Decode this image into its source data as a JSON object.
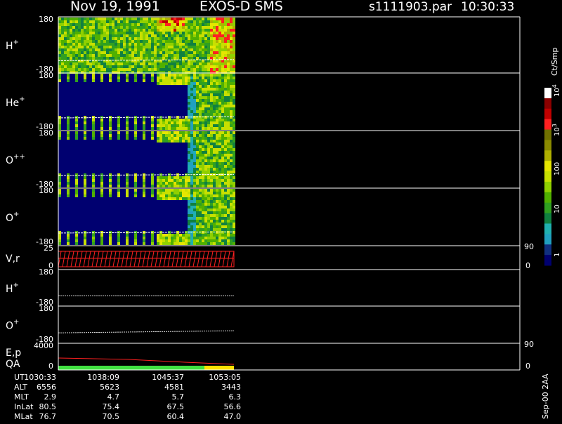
{
  "header": {
    "date": "Nov 19, 1991",
    "instrument": "EXOS-D SMS",
    "file": "s1111903.par",
    "time": "10:30:33"
  },
  "colorbar": {
    "unit": "Ct/Smp",
    "tick_labels": [
      "10^4",
      "10^3",
      "100",
      "10",
      "1"
    ],
    "colors": [
      "#ffffff",
      "#8b0000",
      "#c00000",
      "#ff2020",
      "#707000",
      "#8a8a00",
      "#b0b000",
      "#e6e600",
      "#c8e000",
      "#90d000",
      "#50b000",
      "#30a020",
      "#108040",
      "#20b0b0",
      "#20a0c0",
      "#103080",
      "#000070"
    ]
  },
  "footer_note": "Sep-00 2AA",
  "panels": [
    {
      "id": "h_plus",
      "label_base": "H",
      "label_sup": "+",
      "y_top": "180",
      "y_bottom": "-180",
      "kind": "spectrogram",
      "fill_fraction": 0.34,
      "bg": "#208060"
    },
    {
      "id": "he_plus",
      "label_base": "He",
      "label_sup": "+",
      "y_top": "180",
      "y_bottom": "-180",
      "kind": "spectrogram",
      "fill_fraction": 0.34,
      "bg": "#000070"
    },
    {
      "id": "o_plusplus",
      "label_base": "O",
      "label_sup": "++",
      "y_top": "180",
      "y_bottom": "-180",
      "kind": "spectrogram",
      "fill_fraction": 0.34,
      "bg": "#000070"
    },
    {
      "id": "o_plus",
      "label_base": "O",
      "label_sup": "+",
      "y_top": "180",
      "y_bottom": "-180",
      "kind": "spectrogram",
      "fill_fraction": 0.34,
      "bg": "#000070"
    },
    {
      "id": "v_r",
      "label_base": "V,r",
      "label_sup": "",
      "y_top": "25",
      "y_bottom": "0",
      "right_top": "90",
      "right_bottom": "0",
      "kind": "vr"
    },
    {
      "id": "h_plus_2",
      "label_base": "H",
      "label_sup": "+",
      "y_top": "180",
      "y_bottom": "-180",
      "kind": "line"
    },
    {
      "id": "o_plus_2",
      "label_base": "O",
      "label_sup": "+",
      "y_top": "180",
      "y_bottom": "-180",
      "kind": "line"
    },
    {
      "id": "ep_qa",
      "label_base": "E,p",
      "label_line2": "QA",
      "label_sup": "",
      "y_top": "4000",
      "y_bottom": "0",
      "right_top": "90",
      "right_bottom": "0",
      "kind": "ep"
    }
  ],
  "ephemeris": {
    "rows": [
      {
        "name": "UT",
        "values": [
          "1030:33",
          "1038:09",
          "1045:37",
          "1053:05"
        ]
      },
      {
        "name": "ALT",
        "values": [
          "6556",
          "5623",
          "4581",
          "3443"
        ]
      },
      {
        "name": "MLT",
        "values": [
          "2.9",
          "4.7",
          "5.7",
          "6.3"
        ]
      },
      {
        "name": "InLat",
        "values": [
          "80.5",
          "75.4",
          "67.5",
          "56.6"
        ]
      },
      {
        "name": "MLat",
        "values": [
          "76.7",
          "70.5",
          "60.4",
          "47.0"
        ]
      }
    ]
  },
  "chart_data": {
    "type": "heatmap",
    "title": "Nov 19, 1991 EXOS-D SMS",
    "subtitle": "s1111903.par 10:30:33",
    "x": [
      "1030:33",
      "1038:09",
      "1045:37",
      "1053:05"
    ],
    "xlabel": "UT",
    "species": [
      "H+",
      "He+",
      "O++",
      "O+"
    ],
    "ylim": [
      -180,
      180
    ],
    "colorscale_unit": "Ct/Smp",
    "colorscale_range": [
      1,
      10000
    ],
    "colorscale_type": "log",
    "data_extent_UT": [
      "1030:33",
      "1053:05"
    ],
    "ep_ylim": [
      0,
      4000
    ],
    "vr_ylim": [
      0,
      25
    ],
    "qa_segments": [
      {
        "from": "1030:33",
        "to": "1049:40",
        "color": "#40e040"
      },
      {
        "from": "1049:40",
        "to": "1053:05",
        "color": "#ffe000"
      }
    ]
  }
}
